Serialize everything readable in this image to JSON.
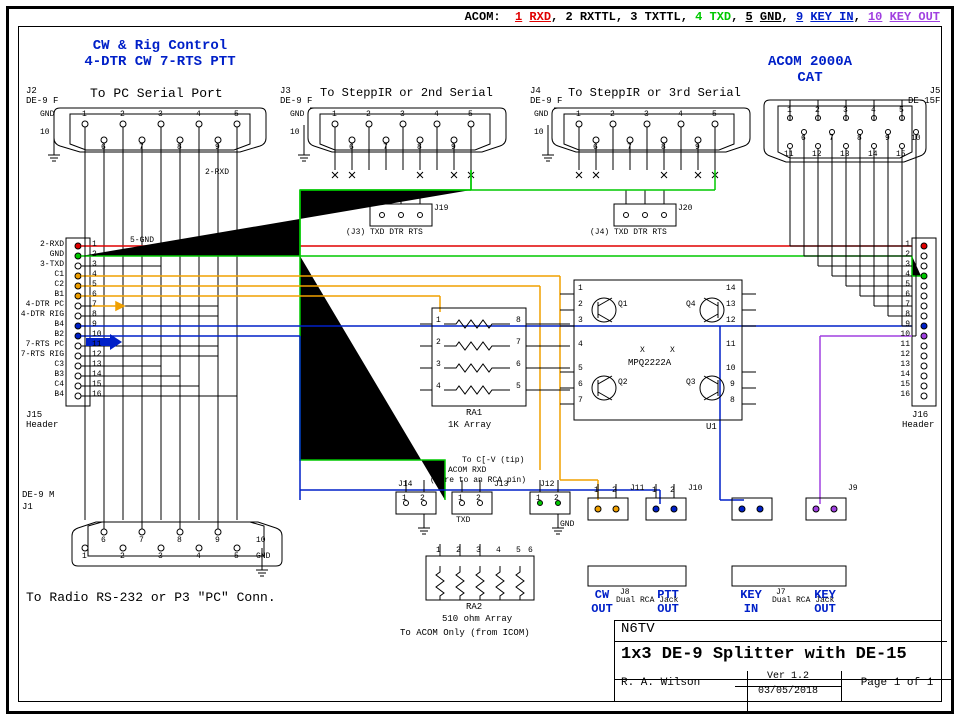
{
  "legend": {
    "prefix": "ACOM:",
    "item1_num": "1",
    "item1_name": "RXD",
    "item2_num": "2",
    "item2_name": "RXTTL",
    "item3_num": "3",
    "item3_name": "TXTTL",
    "item4_num": "4",
    "item4_name": "TXD",
    "item5_num": "5",
    "item5_name": "GND",
    "item9_num": "9",
    "item9_name": "KEY IN",
    "item10_num": "10",
    "item10_name": "KEY OUT"
  },
  "anno": {
    "cw_rig_1": "CW & Rig Control",
    "cw_rig_2": "4-DTR CW   7-RTS PTT",
    "acom2000a": "ACOM 2000A",
    "cat": "CAT",
    "cw_out": "CW",
    "cw_out2": "OUT",
    "ptt_out": "PTT",
    "ptt_out2": "OUT",
    "key_in": "KEY",
    "key_in2": "IN",
    "key_out": "KEY",
    "key_out2": "OUT"
  },
  "labels": {
    "j2a": "J2",
    "j2b": "DE-9 F",
    "j2_title": "To PC Serial Port",
    "j3a": "J3",
    "j3b": "DE-9 F",
    "j3_title": "To SteppIR or 2nd Serial",
    "j4a": "J4",
    "j4b": "DE-9 F",
    "j4_title": "To SteppIR or 3rd Serial",
    "j5a": "J5",
    "j5b": "DE-15F",
    "gnd": "GND",
    "ten": "10",
    "pin1": "1",
    "pin2": "2",
    "pin3": "3",
    "pin4": "4",
    "pin5": "5",
    "pin6": "6",
    "pin7": "7",
    "pin8": "8",
    "pin9": "9",
    "de15_1": "1",
    "de15_2": "2",
    "de15_3": "3",
    "de15_4": "4",
    "de15_5": "5",
    "de15_6": "6",
    "de15_7": "7",
    "de15_8": "8",
    "de15_9": "9",
    "de15_10": "10",
    "de15_11": "11",
    "de15_12": "12",
    "de15_13": "13",
    "de15_14": "14",
    "de15_15": "15",
    "wire_2rxd": "2-RXD",
    "wire_5gnd": "5-GND",
    "j19": "J19",
    "j19_sub": "(J3) TXD DTR RTS",
    "j20": "J20",
    "j20_sub": "(J4) TXD DTR RTS",
    "j15_header_pins": {
      "p1": "2-RXD",
      "p2": "GND",
      "p3": "3-TXD",
      "p4": "C1",
      "p5": "C2",
      "p6": "B1",
      "p7": "4-DTR PC",
      "p8": "4-DTR RIG",
      "p9": "B4",
      "p10": "B2",
      "p11": "7-RTS PC",
      "p12": "7-RTS RIG",
      "p13": "C3",
      "p14": "B3",
      "p15": "C4",
      "p16": "B4"
    },
    "j15_nums": [
      "1",
      "2",
      "3",
      "4",
      "5",
      "6",
      "7",
      "8",
      "9",
      "10",
      "11",
      "12",
      "13",
      "14",
      "15",
      "16"
    ],
    "j15": "J15",
    "header": "Header",
    "j16": "J16",
    "j16_header": "Header",
    "j16_nums": [
      "1",
      "2",
      "3",
      "4",
      "5",
      "6",
      "7",
      "8",
      "9",
      "10",
      "11",
      "12",
      "13",
      "14",
      "15",
      "16"
    ],
    "j1a": "DE-9 M",
    "j1b": "J1",
    "j1_title": "To Radio RS-232 or P3 \"PC\" Conn.",
    "ra1": "RA1",
    "ra1_sub": "1K Array",
    "ra2": "RA2",
    "ra2_val": "510 ohm Array",
    "ra2_title": "To ACOM Only (from ICOM)",
    "u1": "U1",
    "u1_part": "MPQ2222A",
    "q1": "Q1",
    "q2": "Q2",
    "q3": "Q3",
    "q4": "Q4",
    "u1_pins": {
      "1": "1",
      "2": "2",
      "3": "3",
      "4": "4",
      "5": "5",
      "6": "6",
      "7": "7",
      "8": "8",
      "9": "9",
      "10": "10",
      "11": "11",
      "12": "12",
      "13": "13",
      "14": "14"
    },
    "j13": "J13",
    "j14": "J14",
    "txd": "TXD",
    "j13_top": "ACOM RXD",
    "j13_mid": "(wire to an RCA pin)",
    "j12_top": "To C[-V (tip)",
    "j12": "J12",
    "j11": "J11",
    "j10": "J10",
    "j9": "J9",
    "j7": "J7",
    "j8": "J8",
    "dual_rca": "Dual RCA Jack",
    "x": "x",
    "X": "X",
    "pins_12": "1",
    "pins_12b": "2",
    "ra1_p": {
      "1": "1",
      "2": "2",
      "3": "3",
      "4": "4",
      "5": "5",
      "6": "6",
      "7": "7",
      "8": "8"
    },
    "ra2_p": {
      "1": "1",
      "2": "2",
      "3": "3",
      "4": "4",
      "5": "5",
      "6": "6"
    }
  },
  "titleblock": {
    "callsign": "N6TV",
    "title": "1x3 DE-9 Splitter with DE-15",
    "author": "R. A. Wilson",
    "ver": "Ver 1.2",
    "date": "03/05/2018",
    "page": "Page 1 of 1"
  },
  "colors": {
    "red": "#e00000",
    "green": "#00c800",
    "orange": "#f0a000",
    "blue": "#0020c8",
    "navy": "#000080",
    "purple": "#a040e0",
    "black": "#000000"
  }
}
